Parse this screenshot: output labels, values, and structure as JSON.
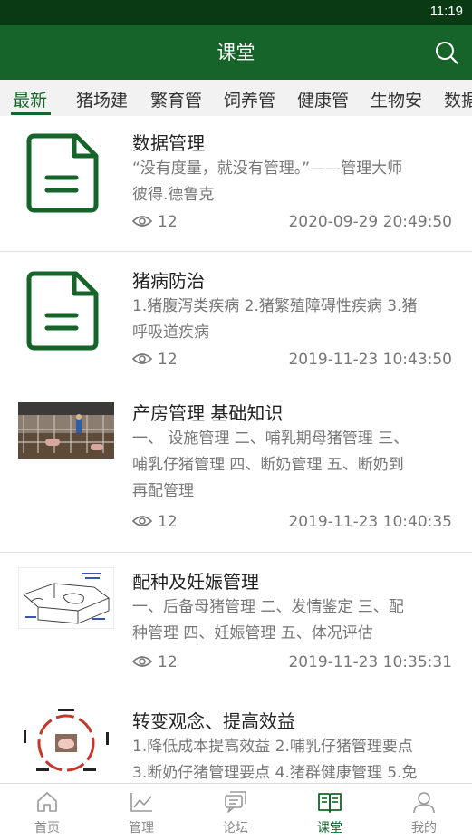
{
  "status": {
    "time": "11:19"
  },
  "header": {
    "title": "课堂",
    "icon": "search-icon"
  },
  "tabs": [
    "最新",
    "猪场建",
    "繁育管",
    "饲养管",
    "健康管",
    "生物安",
    "数据"
  ],
  "articles": [
    {
      "title": "数据管理",
      "desc1": "“没有度量，就没有管理。”——管理大师",
      "desc2": "彼得.德鲁克",
      "views": "12",
      "date": "2020-09-29 20:49:50",
      "thumb": "document-icon"
    },
    {
      "title": "猪病防治",
      "desc1": "1.猪腹泻类疾病 2.猪繁殖障碍性疾病 3.猪",
      "desc2": "呼吸道疾病",
      "views": "12",
      "date": "2019-11-23 10:43:50",
      "thumb": "document-icon"
    },
    {
      "title": "产房管理 基础知识",
      "desc1": "一、 设施管理 二、哺乳期母猪管理 三、",
      "desc2": "哺乳仔猪管理 四、断奶管理 五、断奶到",
      "desc3": "再配管理",
      "views": "12",
      "date": "2019-11-23 10:40:35",
      "thumb": "farrowing-room-photo"
    },
    {
      "title": "配种及妊娠管理",
      "desc1": "一、后备母猪管理 二、发情鉴定 三、配",
      "desc2": "种管理 四、妊娠管理 五、体况评估",
      "views": "12",
      "date": "2019-11-23 10:35:31",
      "thumb": "breeding-sketch-image"
    },
    {
      "title": "转变观念、提高效益",
      "desc1": "1.降低成本提高效益 2.哺乳仔猪管理要点",
      "desc2": "3.断奶仔猪管理要点 4.猪群健康管理 5.免",
      "thumb": "piglet-cycle-diagram"
    }
  ],
  "bottom_nav": [
    {
      "label": "首页",
      "icon": "home-icon"
    },
    {
      "label": "管理",
      "icon": "chart-icon"
    },
    {
      "label": "论坛",
      "icon": "forum-icon"
    },
    {
      "label": "课堂",
      "icon": "book-icon"
    },
    {
      "label": "我的",
      "icon": "profile-icon"
    }
  ],
  "colors": {
    "primary": "#16642a",
    "statusbar": "#0a3a14",
    "text_secondary": "#777777"
  }
}
